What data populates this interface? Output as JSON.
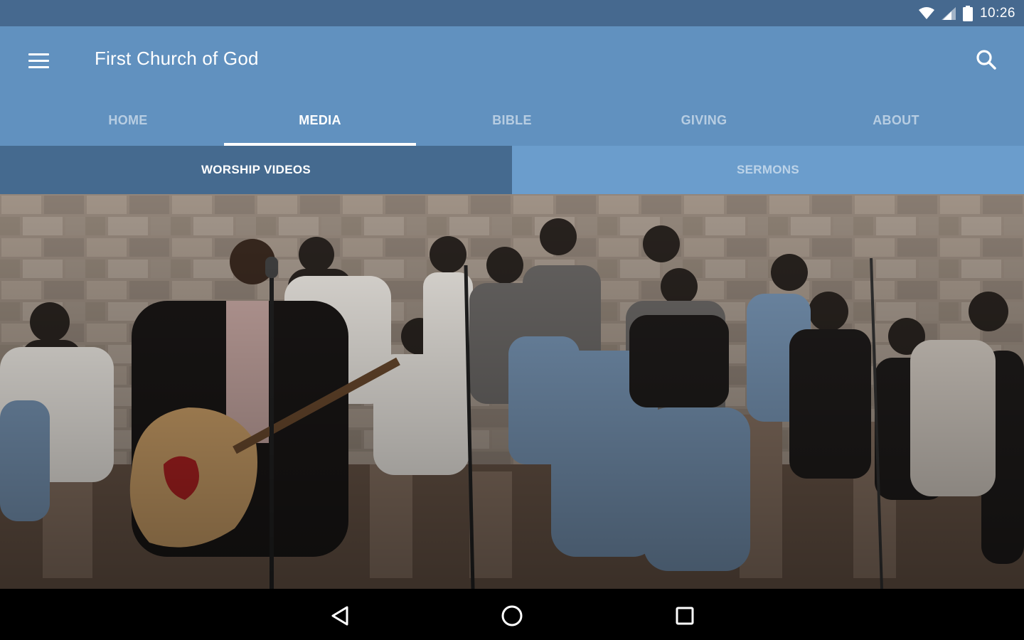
{
  "status_bar": {
    "time": "10:26",
    "icons": [
      "wifi-icon",
      "cellular-signal-icon",
      "battery-icon"
    ]
  },
  "app_bar": {
    "menu_icon": "hamburger-menu-icon",
    "title": "First Church of God",
    "search_icon": "search-icon"
  },
  "tabs": [
    {
      "label": "HOME",
      "active": false
    },
    {
      "label": "MEDIA",
      "active": true
    },
    {
      "label": "BIBLE",
      "active": false
    },
    {
      "label": "GIVING",
      "active": false
    },
    {
      "label": "ABOUT",
      "active": false
    }
  ],
  "sub_tabs": [
    {
      "label": "WORSHIP VIDEOS",
      "active": true
    },
    {
      "label": "SERMONS",
      "active": false
    }
  ],
  "nav_bar": {
    "icons": [
      "back-icon",
      "home-circle-icon",
      "recents-square-icon"
    ]
  },
  "colors": {
    "status_bar": "#46698f",
    "app_bar": "#6191bf",
    "sub_tab_active": "#456a8f",
    "sub_tab_inactive": "#6b9dcc"
  }
}
